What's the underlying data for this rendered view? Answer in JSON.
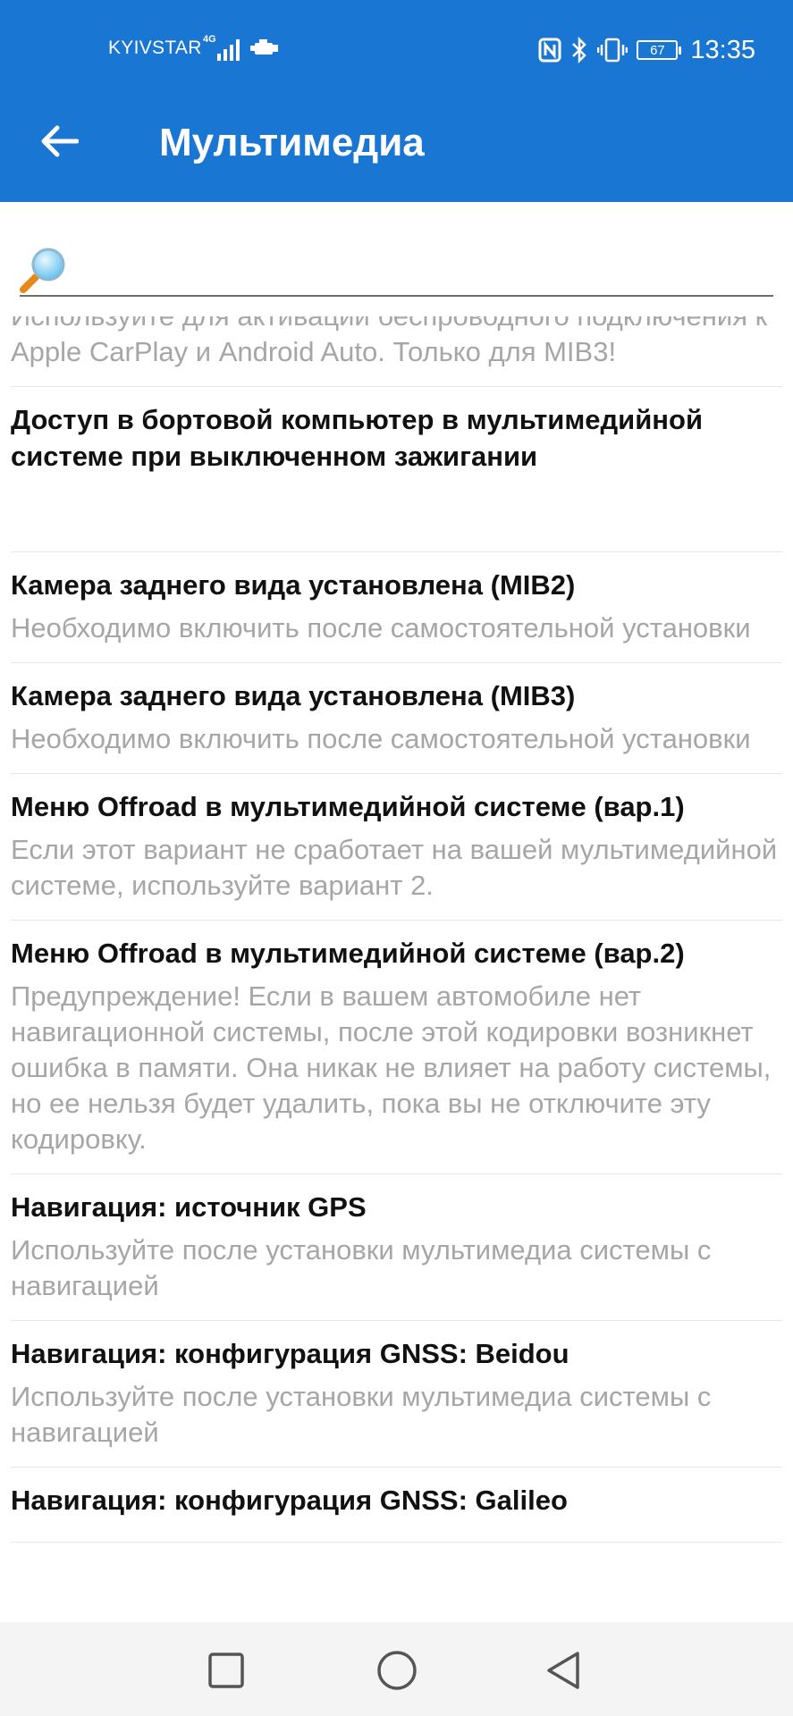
{
  "status_bar": {
    "carrier": "KYIVSTAR",
    "network": "4G",
    "battery": "67",
    "time": "13:35"
  },
  "header": {
    "title": "Мультимедиа",
    "back_icon": "arrow-left-icon",
    "color": "#1976d2"
  },
  "search": {
    "icon": "magnifier-icon",
    "placeholder": ""
  },
  "items": [
    {
      "title": "",
      "desc": "Используйте для активации беспроводного подключения к Apple CarPlay и Android Auto. Только для MIB3!"
    },
    {
      "title": "Доступ в бортовой компьютер в мультимедийной системе при выключенном зажигании",
      "desc": ""
    },
    {
      "title": "Камера заднего вида установлена (MIB2)",
      "desc": "Необходимо включить после самостоятельной установки"
    },
    {
      "title": "Камера заднего вида установлена (MIB3)",
      "desc": "Необходимо включить после самостоятельной установки"
    },
    {
      "title": "Меню Offroad в мультимедийной системе (вар.1)",
      "desc": "Если этот вариант не сработает на вашей мультимедийной системе, используйте вариант 2."
    },
    {
      "title": "Меню Offroad в мультимедийной системе (вар.2)",
      "desc": "Предупреждение! Если в вашем автомобиле нет навигационной системы, после этой кодировки возникнет ошибка в памяти. Она никак не влияет на работу системы, но ее нельзя будет удалить, пока вы не отключите эту кодировку."
    },
    {
      "title": "Навигация: источник GPS",
      "desc": "Используйте после установки мультимедиа системы с навигацией"
    },
    {
      "title": "Навигация: конфигурация GNSS: Beidou",
      "desc": "Используйте после установки мультимедиа системы с навигацией"
    },
    {
      "title": "Навигация: конфигурация GNSS: Galileo",
      "desc": ""
    }
  ],
  "nav_bar": {
    "recents_icon": "square-icon",
    "home_icon": "circle-icon",
    "back_icon": "triangle-back-icon"
  }
}
